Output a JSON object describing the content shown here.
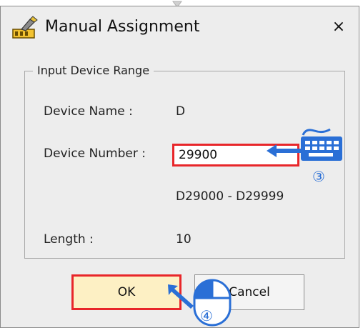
{
  "dialog": {
    "title": "Manual Assignment",
    "close_label": "×"
  },
  "group": {
    "legend": "Input Device Range"
  },
  "device_name": {
    "label": "Device Name :",
    "value": "D"
  },
  "device_number": {
    "label": "Device Number :",
    "value": "29900"
  },
  "range": {
    "text": "D29000 - D29999"
  },
  "length": {
    "label": "Length :",
    "value": "10"
  },
  "buttons": {
    "ok_label": "OK",
    "cancel_label": "Cancel"
  },
  "annotations": {
    "step3": "③",
    "step4": "④"
  },
  "icons": {
    "title": "manual-assignment-icon",
    "keyboard": "keyboard-icon",
    "mouse": "mouse-left-click-icon",
    "arrow": "arrow-icon"
  },
  "colors": {
    "highlight": "#e8262a",
    "annotation": "#2a6fd6",
    "ok_fill": "#fdf0c4",
    "dialog_bg": "#ededed"
  }
}
